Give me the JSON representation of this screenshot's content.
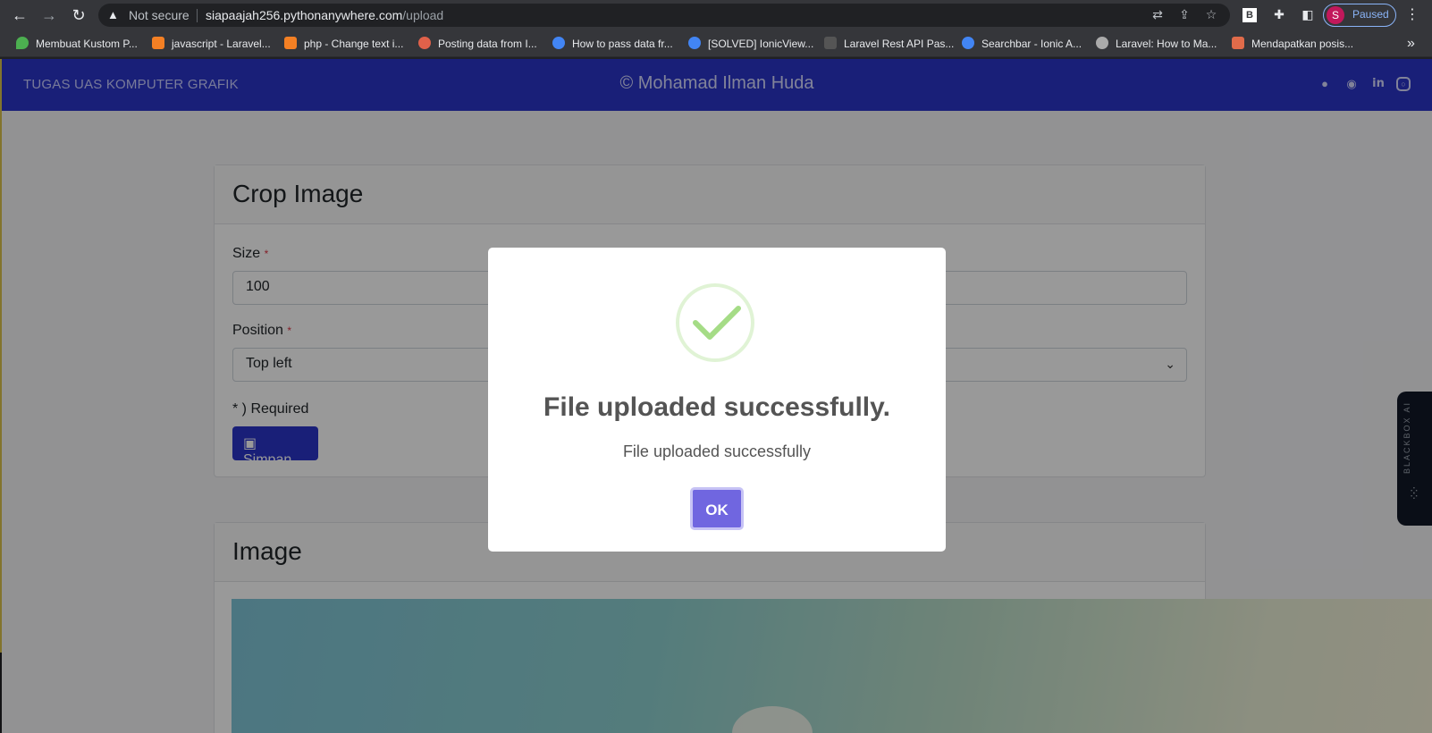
{
  "browser": {
    "not_secure": "Not secure",
    "url_host": "siapaajah256.pythonanywhere.com",
    "url_path": "/upload",
    "profile_initial": "S",
    "profile_status": "Paused",
    "bookmarks": [
      {
        "label": "Membuat Kustom P...",
        "color": "#4caf50"
      },
      {
        "label": "javascript - Laravel...",
        "color": "#f48024"
      },
      {
        "label": "php - Change text i...",
        "color": "#f48024"
      },
      {
        "label": "Posting data from I...",
        "color": "#e0614a"
      },
      {
        "label": "How to pass data fr...",
        "color": "#4285f4"
      },
      {
        "label": "[SOLVED] IonicView...",
        "color": "#4285f4"
      },
      {
        "label": "Laravel Rest API Pas...",
        "color": "#555555"
      },
      {
        "label": "Searchbar - Ionic A...",
        "color": "#4285f4"
      },
      {
        "label": "Laravel: How to Ma...",
        "color": "#aaaaaa"
      },
      {
        "label": "Mendapatkan posis...",
        "color": "#e06b4a"
      }
    ],
    "more": "»"
  },
  "app": {
    "brand": "TUGAS UAS KOMPUTER GRAFIK",
    "copyright": "© Mohamad Ilman Huda",
    "social": [
      "github-icon",
      "chrome-icon",
      "linkedin-icon",
      "instagram-icon"
    ]
  },
  "crop_card": {
    "title": "Crop Image",
    "size_label": "Size",
    "required_mark": "*",
    "size_value": "100",
    "position_label": "Position",
    "position_value": "Top left",
    "required_note": "* ) Required",
    "save_label": "Simpan"
  },
  "image_card": {
    "title": "Image"
  },
  "modal": {
    "title": "File uploaded successfully.",
    "text": "File uploaded successfully",
    "ok_label": "OK"
  },
  "sidebar_widget": {
    "label": "BLACKBOX AI"
  },
  "colors": {
    "appbar": "#2b35c9",
    "ok_button": "#7066e0",
    "success": "#a5dc86"
  }
}
